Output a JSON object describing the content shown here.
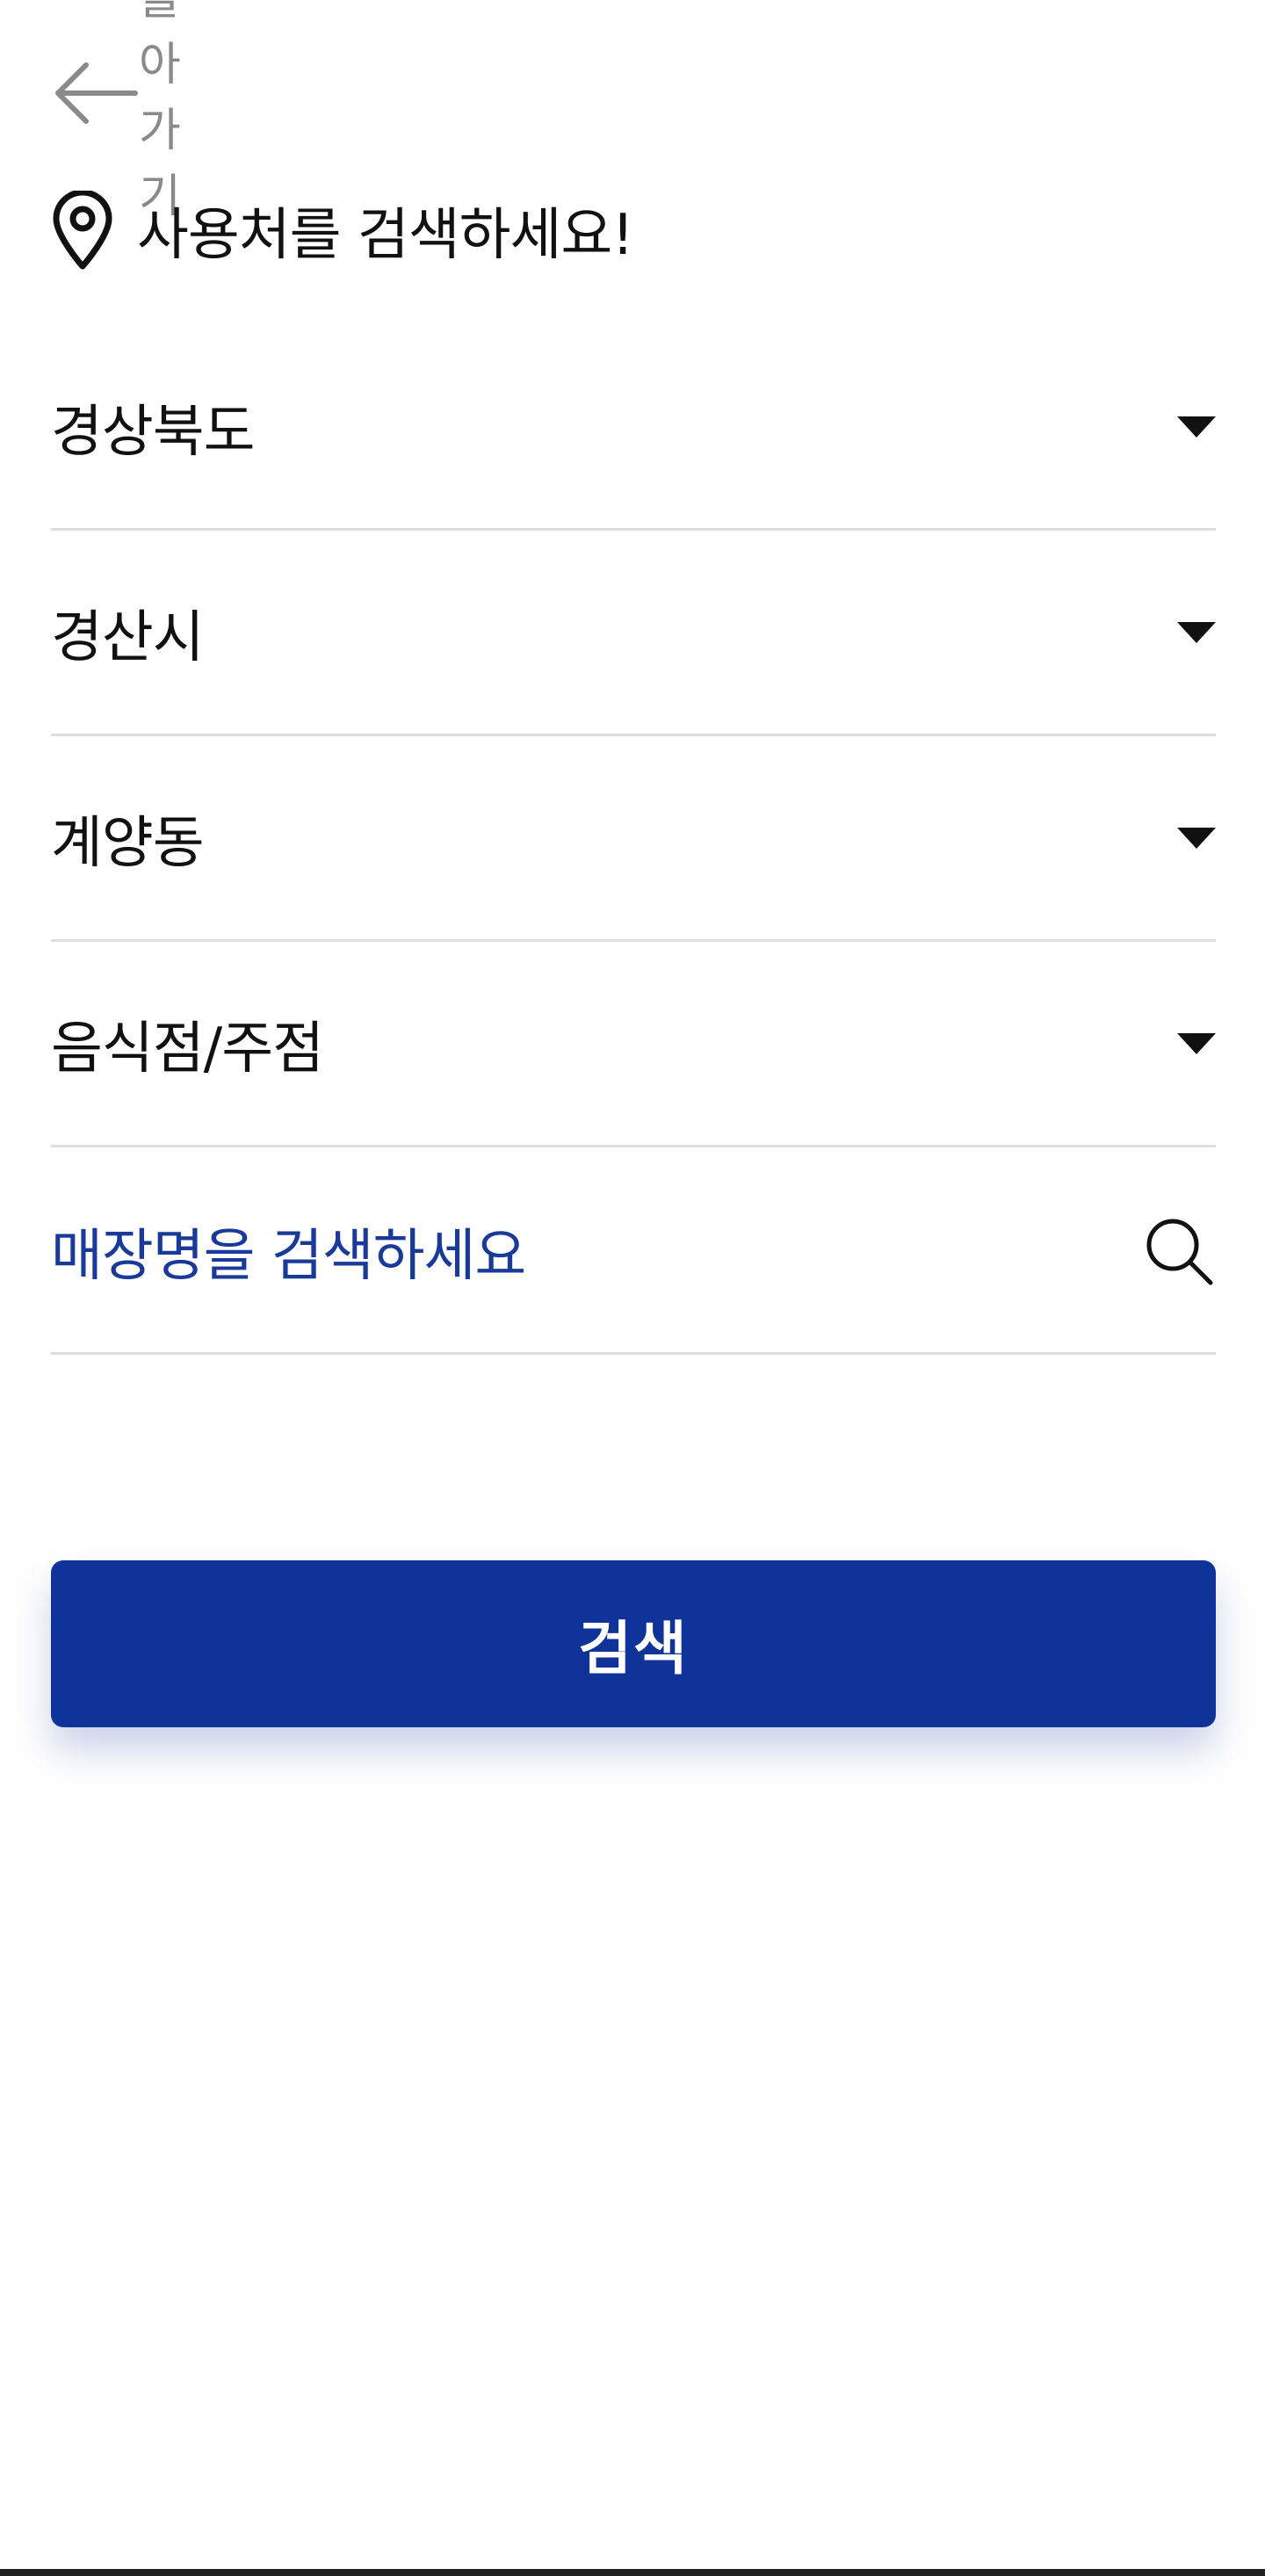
{
  "header": {
    "back_label": "돌아가기",
    "back_icon": "arrow-left-icon",
    "title": "사용처를 검색하세요!",
    "title_icon": "map-pin-icon"
  },
  "filters": {
    "province": "경상북도",
    "city": "경산시",
    "district": "계양동",
    "category": "음식점/주점",
    "dropdown_icon": "caret-down-icon"
  },
  "search": {
    "placeholder": "매장명을 검색하세요",
    "icon": "search-icon"
  },
  "actions": {
    "submit_label": "검색"
  },
  "colors": {
    "primary": "#10339a",
    "placeholder_text": "#1a3a9a",
    "back_text": "#8a8a8a",
    "divider": "#dedede",
    "text": "#111111",
    "background": "#ffffff"
  }
}
